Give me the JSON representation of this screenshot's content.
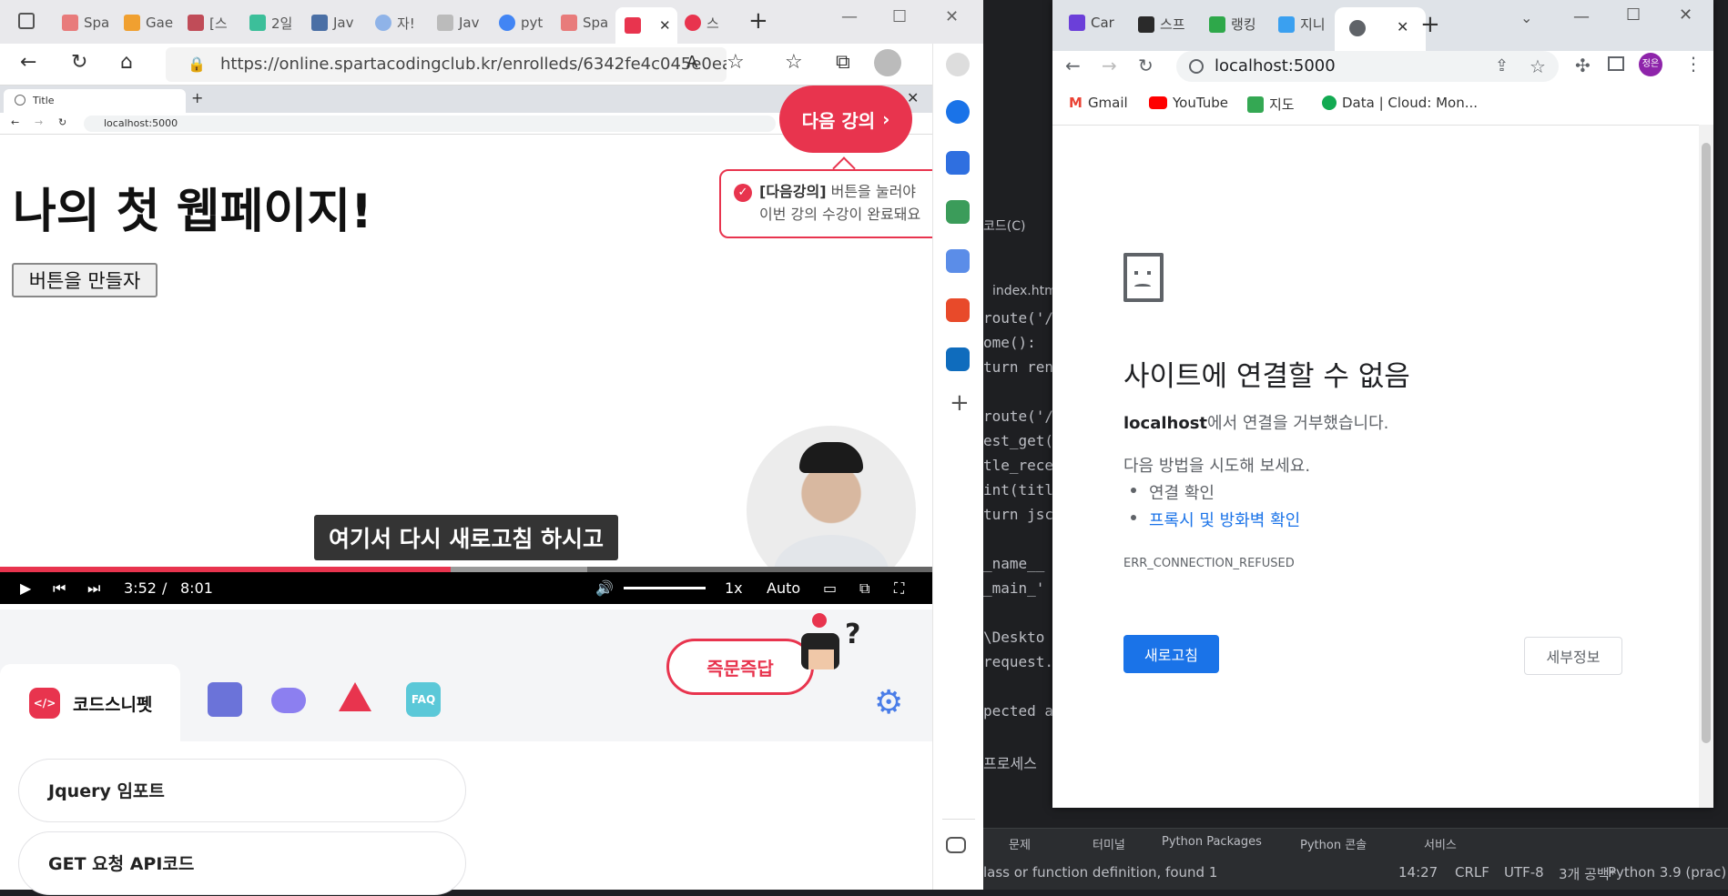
{
  "edge": {
    "tabs": [
      "Spa",
      "Gae",
      "[스",
      "2일",
      "Jav",
      "자!",
      "Jav",
      "pyt",
      "Spa",
      "",
      "스"
    ],
    "new_tab": "+",
    "url": "https://online.spartacodingclub.kr/enrolleds/6342fe4c045e0eab...",
    "sidebar_plus": "+"
  },
  "video": {
    "inner_tab_title": "Title",
    "inner_url": "localhost:5000",
    "page_heading": "나의 첫 웹페이지!",
    "page_button": "버튼을 만들자",
    "next_lecture": "다음 강의",
    "tooltip_bold": "[다음강의]",
    "tooltip_line1": " 버튼을 눌러야",
    "tooltip_line2": "이번 강의 수강이 완료돼요",
    "subtitle": "여기서 다시 새로고침 하시고",
    "progress_fraction": 0.483,
    "time_current": "3:52",
    "time_sep": "/",
    "time_total": "8:01",
    "speed": "1x",
    "quality": "Auto"
  },
  "panel": {
    "snippet_tab": "코드스니펫",
    "quiz_button": "즉문즉답",
    "faq_label": "FAQ",
    "items": [
      "Jquery 임포트",
      "GET 요청 API코드"
    ]
  },
  "ide": {
    "menu_fragment": "코드(C)",
    "file_tab": "index.htm",
    "code_lines": [
      "route('/",
      "ome():",
      "turn ren",
      "",
      "route('/",
      "est_get(",
      "tle_rece",
      "int(titl",
      "turn jsc",
      "",
      "_name__ =",
      "_main_'",
      "",
      "\\Deskto",
      "request.",
      "",
      "pected a",
      "",
      " 프로세스"
    ],
    "toolwin": [
      "문제",
      "터미널",
      "Python Packages",
      "Python 콘솔",
      "서비스"
    ],
    "status_msg": "lass or function definition, found 1",
    "status_pos": "14:27",
    "status_crlf": "CRLF",
    "status_enc": "UTF-8",
    "status_indent": "3개 공백*",
    "status_interp": "Python 3.9 (prac)"
  },
  "chrome": {
    "tabs": [
      "Car",
      "스프",
      "랭킹",
      "지니",
      ""
    ],
    "url": "localhost:5000",
    "bookmarks": [
      "Gmail",
      "YouTube",
      "지도",
      "Data | Cloud: Mon..."
    ],
    "profile": "정은",
    "error": {
      "heading": "사이트에 연결할 수 없음",
      "host": "localhost",
      "refused": "에서 연결을 거부했습니다.",
      "try": "다음 방법을 시도해 보세요.",
      "check": "연결 확인",
      "proxy": "프록시 및 방화벽 확인",
      "code": "ERR_CONNECTION_REFUSED",
      "reload": "새로고침",
      "details": "세부정보"
    }
  },
  "colors": {
    "accent_red": "#e8344e",
    "chrome_blue": "#1a73e8"
  }
}
